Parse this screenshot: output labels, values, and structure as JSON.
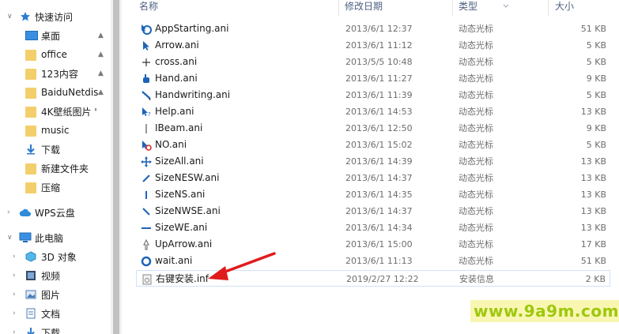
{
  "nav": {
    "quick_access": {
      "label": "快速访问",
      "icon": "star-icon"
    },
    "pinned": [
      {
        "label": "桌面",
        "icon": "desktop-icon"
      },
      {
        "label": "office",
        "icon": "folder-icon"
      },
      {
        "label": "123内容",
        "icon": "folder-icon"
      },
      {
        "label": "BaiduNetdis",
        "icon": "folder-icon"
      },
      {
        "label": "4K壁纸图片 '",
        "icon": "folder-icon"
      }
    ],
    "unpinned": [
      {
        "label": "music",
        "icon": "folder-icon"
      },
      {
        "label": "下载",
        "icon": "download-icon"
      },
      {
        "label": "新建文件夹",
        "icon": "folder-icon"
      },
      {
        "label": "压缩",
        "icon": "folder-icon"
      }
    ],
    "wps": {
      "label": "WPS云盘",
      "icon": "cloud-icon"
    },
    "this_pc": {
      "label": "此电脑",
      "icon": "computer-icon"
    },
    "pc_children": [
      {
        "label": "3D 对象",
        "icon": "cube-icon"
      },
      {
        "label": "视频",
        "icon": "video-icon"
      },
      {
        "label": "图片",
        "icon": "picture-icon"
      },
      {
        "label": "文档",
        "icon": "document-icon"
      },
      {
        "label": "下载",
        "icon": "download-icon"
      }
    ]
  },
  "columns": {
    "name": "名称",
    "date": "修改日期",
    "type": "类型",
    "size": "大小"
  },
  "files": [
    {
      "name": "AppStarting.ani",
      "date": "2013/6/1 12:37",
      "type": "动态光标",
      "size": "51 KB",
      "icon": "app-starting-cursor-icon"
    },
    {
      "name": "Arrow.ani",
      "date": "2013/6/1 11:12",
      "type": "动态光标",
      "size": "5 KB",
      "icon": "arrow-cursor-icon"
    },
    {
      "name": "cross.ani",
      "date": "2013/5/5 10:48",
      "type": "动态光标",
      "size": "5 KB",
      "icon": "cross-cursor-icon"
    },
    {
      "name": "Hand.ani",
      "date": "2013/6/1 11:27",
      "type": "动态光标",
      "size": "9 KB",
      "icon": "hand-cursor-icon"
    },
    {
      "name": "Handwriting.ani",
      "date": "2013/6/1 11:39",
      "type": "动态光标",
      "size": "5 KB",
      "icon": "handwriting-cursor-icon"
    },
    {
      "name": "Help.ani",
      "date": "2013/6/1 14:53",
      "type": "动态光标",
      "size": "13 KB",
      "icon": "help-cursor-icon"
    },
    {
      "name": "IBeam.ani",
      "date": "2013/6/1 12:50",
      "type": "动态光标",
      "size": "9 KB",
      "icon": "ibeam-cursor-icon"
    },
    {
      "name": "NO.ani",
      "date": "2013/6/1 15:02",
      "type": "动态光标",
      "size": "5 KB",
      "icon": "no-cursor-icon"
    },
    {
      "name": "SizeAll.ani",
      "date": "2013/6/1 14:39",
      "type": "动态光标",
      "size": "13 KB",
      "icon": "size-all-cursor-icon"
    },
    {
      "name": "SizeNESW.ani",
      "date": "2013/6/1 14:37",
      "type": "动态光标",
      "size": "13 KB",
      "icon": "size-nesw-cursor-icon"
    },
    {
      "name": "SizeNS.ani",
      "date": "2013/6/1 14:35",
      "type": "动态光标",
      "size": "13 KB",
      "icon": "size-ns-cursor-icon"
    },
    {
      "name": "SizeNWSE.ani",
      "date": "2013/6/1 14:37",
      "type": "动态光标",
      "size": "13 KB",
      "icon": "size-nwse-cursor-icon"
    },
    {
      "name": "SizeWE.ani",
      "date": "2013/6/1 14:34",
      "type": "动态光标",
      "size": "13 KB",
      "icon": "size-we-cursor-icon"
    },
    {
      "name": "UpArrow.ani",
      "date": "2013/6/1 15:00",
      "type": "动态光标",
      "size": "17 KB",
      "icon": "up-arrow-cursor-icon"
    },
    {
      "name": "wait.ani",
      "date": "2013/6/1 11:13",
      "type": "动态光标",
      "size": "51 KB",
      "icon": "wait-cursor-icon"
    },
    {
      "name": "右键安装.inf",
      "date": "2019/2/27 12:22",
      "type": "安装信息",
      "size": "2 KB",
      "icon": "setup-info-file-icon"
    }
  ],
  "watermark": "www.9a9m.com",
  "colors": {
    "accent": "#0a64c8",
    "folder": "#f3cf6b",
    "arrow": "#e01b1b",
    "watermark": "#9ec80e"
  }
}
